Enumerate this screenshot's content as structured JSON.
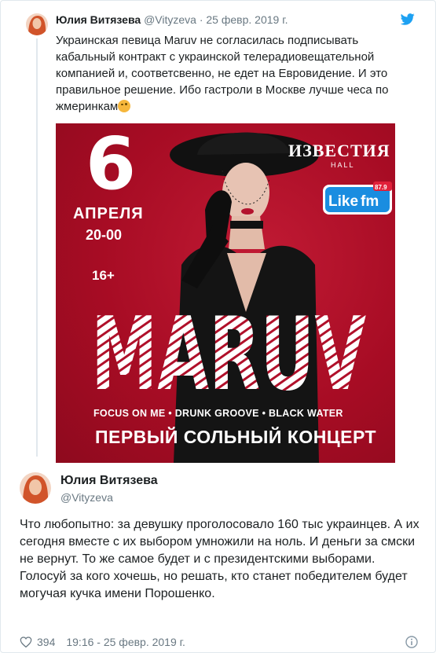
{
  "colors": {
    "accent": "#1da1f2",
    "poster_bg": "#b0102a",
    "secondary_text": "#697882"
  },
  "quoted_tweet": {
    "name": "Юлия Витязева",
    "handle": "@Vityzeva",
    "dot": "·",
    "date": "25 февр. 2019 г.",
    "text": "Украинская певица Maruv не согласилась подписывать кабальный контракт с украинской телерадиовещательной компанией и, соответсвенно, не едет на Евровидение. И это правильное решение. Ибо гастроли в Москве лучше чеса по жмеринкам",
    "emoji": "winking-face-icon",
    "bird_icon": "twitter-bird-icon",
    "poster": {
      "day": "6",
      "month": "АПРЕЛЯ",
      "time": "20-00",
      "age": "16+",
      "venue": "ИЗВЕСТИЯ",
      "venue_sub": "HALL",
      "radio_like": "Like",
      "radio_fm": "fm",
      "radio_freq": "87.9",
      "artist": "MARUV",
      "songs": "FOCUS ON ME  •  DRUNK GROOVE  •  BLACK WATER",
      "title": "ПЕРВЫЙ СОЛЬНЫЙ КОНЦЕРТ"
    }
  },
  "main_tweet": {
    "name": "Юлия Витязева",
    "handle": "@Vityzeva",
    "text": "Что любопытно: за девушку проголосовало 160 тыс украинцев. А их сегодня вместе с их выбором умножили на ноль. И деньги за смски не вернут. То же самое будет и с президентскими выборами. Голосуй за кого хочешь, но решать, кто станет победителем будет могучая кучка имени Порошенко.",
    "likes": "394",
    "timestamp": "19:16 - 25 февр. 2019 г.",
    "heart_icon": "heart-icon",
    "info_icon": "info-icon"
  }
}
